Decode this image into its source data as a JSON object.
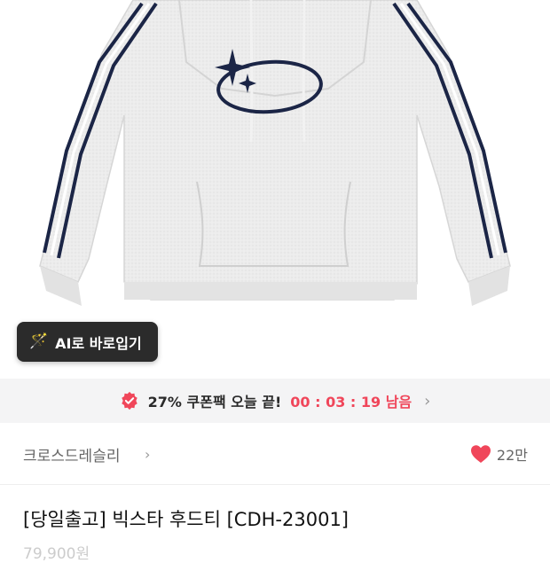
{
  "ai_tryon": {
    "icon": "magic-wand-icon",
    "label": "AI로 바로입기"
  },
  "coupon": {
    "icon": "coupon-badge-icon",
    "text": "27% 쿠폰팩 오늘 끝!",
    "countdown": "00 : 03 : 19 남음",
    "accent": "#f0465a"
  },
  "brand": {
    "name": "크로스드레슬리",
    "chevron": "›"
  },
  "likes": {
    "icon": "heart-icon",
    "count": "22만",
    "color": "#f0465a"
  },
  "product": {
    "title": "[당일출고] 빅스타 후드티 [CDH-23001]",
    "price_partial": "79,900원"
  }
}
